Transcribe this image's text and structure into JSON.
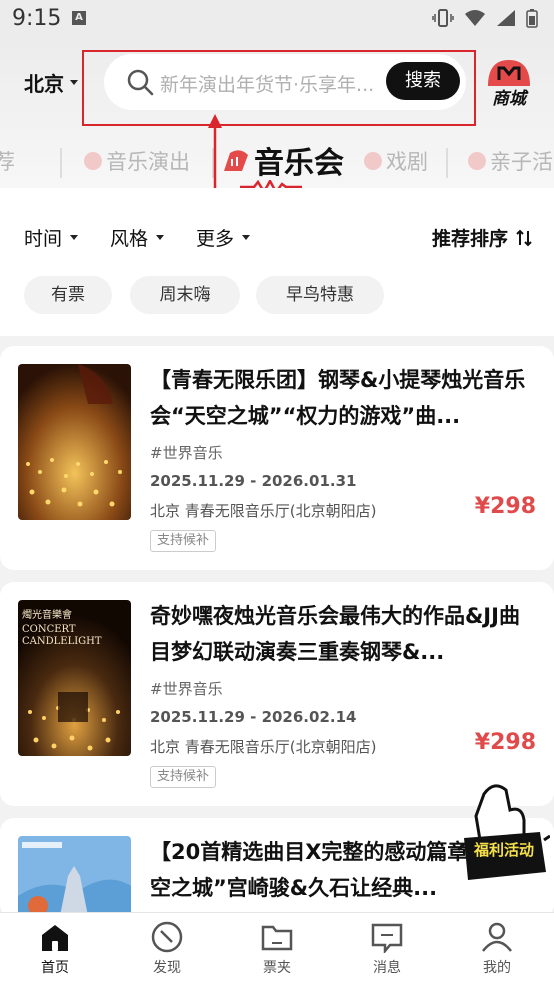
{
  "status_bar": {
    "time": "9:15",
    "notification_glyph": "A"
  },
  "header": {
    "city": "北京",
    "search_placeholder": "新年演出年货节·乐享年...",
    "search_button": "搜索",
    "mall_label": "商城"
  },
  "category_tabs": [
    {
      "label": "荐",
      "active": false
    },
    {
      "label": "音乐演出",
      "active": false
    },
    {
      "label": "音乐会",
      "active": true
    },
    {
      "label": "戏剧",
      "active": false
    },
    {
      "label": "亲子活",
      "active": false
    }
  ],
  "filters": [
    {
      "label": "时间"
    },
    {
      "label": "风格"
    },
    {
      "label": "更多"
    }
  ],
  "sort_label": "推荐排序",
  "chips": [
    "有票",
    "周末嗨",
    "早鸟特惠"
  ],
  "events": [
    {
      "title": "【青春无限乐团】钢琴&小提琴烛光音乐会“天空之城”“权力的游戏”曲...",
      "tag": "#世界音乐",
      "date": "2025.11.29 - 2026.01.31",
      "venue": "北京 青春无限音乐厅(北京朝阳店)",
      "price": "¥298",
      "badge": "支持候补"
    },
    {
      "title": "奇妙嘿夜烛光音乐会最伟大的作品&JJ曲目梦幻联动演奏三重奏钢琴&...",
      "tag": "#世界音乐",
      "date": "2025.11.29 - 2026.02.14",
      "venue": "北京 青春无限音乐厅(北京朝阳店)",
      "price": "¥298",
      "badge": "支持候补",
      "poster_text": [
        "燭光音樂會",
        "CONCERT",
        "CANDLELIGHT"
      ]
    },
    {
      "title": "【20首精选曲目X完整的感动篇章】“天空之城”宫崎骏&久石让经典...",
      "tag": "",
      "date": "",
      "venue": "",
      "price": "",
      "badge": ""
    }
  ],
  "promo_label": "福利活动",
  "bottom_nav": [
    {
      "label": "首页",
      "active": true
    },
    {
      "label": "发现",
      "active": false
    },
    {
      "label": "票夹",
      "active": false
    },
    {
      "label": "消息",
      "active": false
    },
    {
      "label": "我的",
      "active": false
    }
  ],
  "colors": {
    "accent_red": "#e04a4a",
    "annotation_red": "#d9262c",
    "search_button": "#111111"
  }
}
